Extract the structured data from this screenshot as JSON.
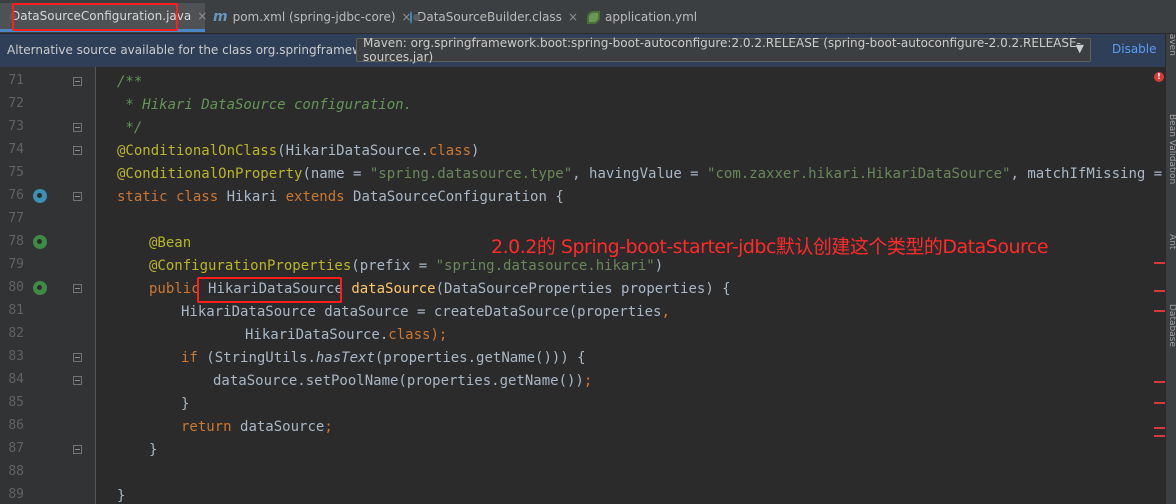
{
  "tabs": [
    {
      "label": "DataSourceConfiguration.java",
      "icon": "class-icon",
      "active": true
    },
    {
      "label": "pom.xml (spring-jdbc-core)",
      "icon": "maven-icon",
      "active": false
    },
    {
      "label": "DataSourceBuilder.class",
      "icon": "class-icon",
      "active": false
    },
    {
      "label": "application.yml",
      "icon": "spring-config-icon",
      "active": false
    }
  ],
  "maven_icon_glyph": "m",
  "close_glyph": "×",
  "banner": {
    "text": "Alternative source available for the class org.springframework.b...",
    "source_value": "Maven: org.springframework.boot:spring-boot-autoconfigure:2.0.2.RELEASE (spring-boot-autoconfigure-2.0.2.RELEASE-sources.jar)",
    "caret": "▼",
    "disable_label": "Disable"
  },
  "line_numbers": [
    "71",
    "72",
    "73",
    "74",
    "75",
    "76",
    "77",
    "78",
    "79",
    "80",
    "81",
    "82",
    "83",
    "84",
    "85",
    "86",
    "87",
    "88",
    "89"
  ],
  "annotation": "2.0.2的 Spring-boot-starter-jdbc默认创建这个类型的DataSource",
  "side_labels": [
    "Maven",
    "Bean Validation",
    "Ant",
    "Database"
  ],
  "error_glyph": "!",
  "colors": {
    "accent": "#4a88c7",
    "annotation_red": "#ff1e1e",
    "banner_bg": "#2f3f58",
    "link": "#589df6"
  },
  "code": {
    "l71": "/**",
    "l72": " * Hikari DataSource configuration.",
    "l73": " */",
    "l74_a": "@ConditionalOnClass",
    "l74_b": "(HikariDataSource.",
    "l74_c": "class",
    "l74_d": ")",
    "l75_a": "@ConditionalOnProperty",
    "l75_b": "(name = ",
    "l75_c": "\"spring.datasource.type\"",
    "l75_d": ", havingValue = ",
    "l75_e": "\"com.zaxxer.hikari.HikariDataSource\"",
    "l75_f": ", matchIfMissing = ",
    "l75_g": "true",
    "l75_h": ")",
    "l76_a": "static class ",
    "l76_b": "Hikari ",
    "l76_c": "extends ",
    "l76_d": "DataSourceConfiguration {",
    "l78": "@Bean",
    "l79_a": "@ConfigurationProperties",
    "l79_b": "(prefix = ",
    "l79_c": "\"spring.datasource.hikari\"",
    "l79_d": ")",
    "l80_a": "public ",
    "l80_b": "HikariDataSource ",
    "l80_c": "dataSource",
    "l80_d": "(DataSourceProperties properties) {",
    "l81_a": "HikariDataSource dataSource = createDataSource(properties",
    "l81_b": ",",
    "l82_a": "HikariDataSource.",
    "l82_b": "class",
    "l82_c": ");",
    "l83_a": "if ",
    "l83_b": "(StringUtils.",
    "l83_c": "hasText",
    "l83_d": "(properties.getName())) {",
    "l84_a": "dataSource.setPoolName(properties.getName())",
    "l84_b": ";",
    "l85": "}",
    "l86_a": "return ",
    "l86_b": "dataSource",
    "l86_c": ";",
    "l87": "}",
    "l89": "}"
  }
}
